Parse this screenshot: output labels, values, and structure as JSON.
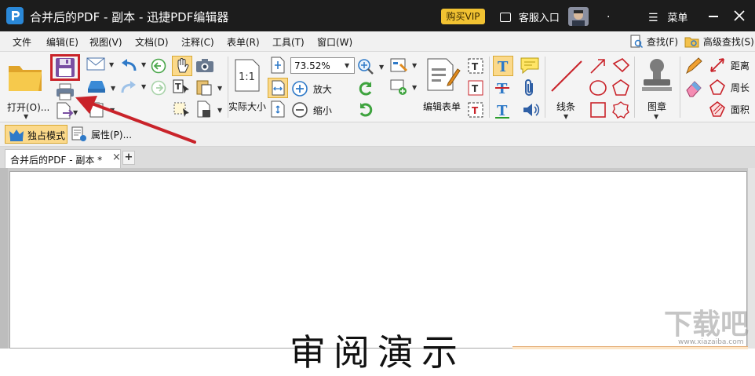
{
  "titlebar": {
    "app_title": "合并后的PDF - 副本 - 迅捷PDF编辑器",
    "vip_label": "购买VIP",
    "service_label": "客服入口",
    "dot_label": ".",
    "menu_label": "菜单"
  },
  "menubar": {
    "items": [
      "文件",
      "编辑(E)",
      "视图(V)",
      "文档(D)",
      "注释(C)",
      "表单(R)",
      "工具(T)",
      "窗口(W)"
    ],
    "find_label": "查找(F)",
    "adv_find_label": "高级查找(S)"
  },
  "ribbon": {
    "open_label": "打开(O)...",
    "actual_size_label": "实际大小",
    "zoom_value": "73.52%",
    "zoom_in_label": "放大",
    "zoom_out_label": "缩小",
    "edit_form_label": "编辑表单",
    "line_label": "线条",
    "stamp_label": "图章",
    "distance_label": "距离",
    "perimeter_label": "周长",
    "area_label": "面积"
  },
  "modebar": {
    "exclusive_label": "独占模式",
    "properties_label": "属性(P)..."
  },
  "tabs": {
    "doc_tab_label": "合并后的PDF - 副本 *",
    "close_glyph": "×",
    "add_glyph": "+"
  },
  "document": {
    "heading_fragment": "审阅演示"
  },
  "watermark": {
    "text": "下载吧",
    "url": "www.xiazaiba.com"
  },
  "colors": {
    "titlebar_bg": "#1c1c1c",
    "vip_bg": "#f1c232",
    "annotation_red": "#c9232a",
    "accent_blue": "#2f7ac8"
  }
}
